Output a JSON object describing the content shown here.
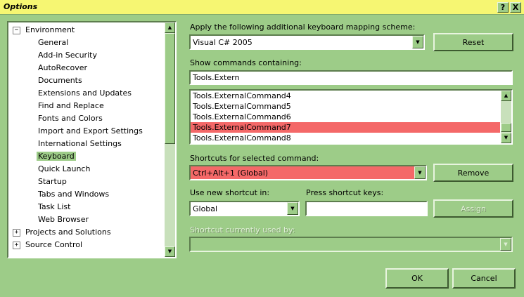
{
  "window": {
    "title": "Options",
    "help_label": "?",
    "close_label": "X"
  },
  "tree": {
    "items": [
      {
        "label": "Environment",
        "level": 0,
        "expander": "−"
      },
      {
        "label": "General",
        "level": 1
      },
      {
        "label": "Add-in Security",
        "level": 1
      },
      {
        "label": "AutoRecover",
        "level": 1
      },
      {
        "label": "Documents",
        "level": 1
      },
      {
        "label": "Extensions and Updates",
        "level": 1
      },
      {
        "label": "Find and Replace",
        "level": 1
      },
      {
        "label": "Fonts and Colors",
        "level": 1
      },
      {
        "label": "Import and Export Settings",
        "level": 1
      },
      {
        "label": "International Settings",
        "level": 1
      },
      {
        "label": "Keyboard",
        "level": 1,
        "selected": true
      },
      {
        "label": "Quick Launch",
        "level": 1
      },
      {
        "label": "Startup",
        "level": 1
      },
      {
        "label": "Tabs and Windows",
        "level": 1
      },
      {
        "label": "Task List",
        "level": 1
      },
      {
        "label": "Web Browser",
        "level": 1
      },
      {
        "label": "Projects and Solutions",
        "level": 0,
        "expander": "+"
      },
      {
        "label": "Source Control",
        "level": 0,
        "expander": "+"
      }
    ]
  },
  "mapping": {
    "label": "Apply the following additional keyboard mapping scheme:",
    "value": "Visual C# 2005",
    "reset_label": "Reset"
  },
  "commands": {
    "label": "Show commands containing:",
    "filter_value": "Tools.Extern",
    "items": [
      {
        "label": "Tools.ExternalCommand4"
      },
      {
        "label": "Tools.ExternalCommand5"
      },
      {
        "label": "Tools.ExternalCommand6"
      },
      {
        "label": "Tools.ExternalCommand7",
        "selected": true
      },
      {
        "label": "Tools.ExternalCommand8"
      }
    ]
  },
  "shortcuts": {
    "label": "Shortcuts for selected command:",
    "value": "Ctrl+Alt+1 (Global)",
    "remove_label": "Remove"
  },
  "new_shortcut": {
    "use_in_label": "Use new shortcut in:",
    "use_in_value": "Global",
    "press_label": "Press shortcut keys:",
    "press_value": "",
    "assign_label": "Assign"
  },
  "used_by": {
    "label": "Shortcut currently used by:",
    "value": ""
  },
  "footer": {
    "ok_label": "OK",
    "cancel_label": "Cancel"
  },
  "colors": {
    "background": "#9dcc88",
    "titlebar": "#f6f672",
    "selection": "#f46868"
  },
  "icons": {
    "scroll_up": "triangle-up-icon",
    "scroll_down": "triangle-down-icon",
    "dropdown": "chevron-down-icon"
  }
}
